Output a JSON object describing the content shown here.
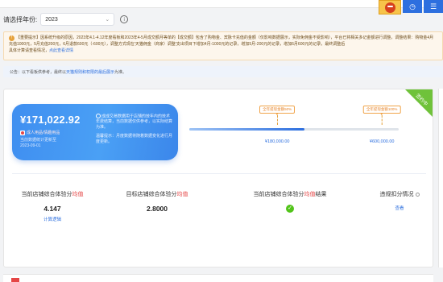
{
  "header": {
    "year_label": "请选择年份:",
    "year_value": "2023"
  },
  "notice": {
    "prefix": "【重要提示】",
    "text": "因系统升级的原因，2023年4.1-4.12年度看板和2023年4-5月成交额月等单的【成交额】包含了购物金、宾脉卡充值的金额（仅影响数据展示，实际免佣金不受影响），平台已将相关多记金额进行调整，调整结果：购物金4月充值1000元，5月充值200元，6月退款600元（-600元），调整方式现在'天猫佣金（商家）调整'支出项目下增加4月-1000元的记录，增加5月-200元的记录，增加6月600元的记录，最终调整后",
    "suffix": "具体计算请查看情况，",
    "link": "点此查看详情"
  },
  "reference": {
    "text": "公告：以下看板供参考，最终以",
    "link": "天猫规则和权限的最后展示",
    "suffix": "为准。"
  },
  "ribbon": "签约中",
  "card": {
    "amount": "¥171,022.92",
    "badge": "成人用品/情趣用品",
    "sub1": "当前数据统计更新至",
    "sub2": "2023-09-01",
    "desc": "成成交易数据用于店铺的技年内的技术年费结算，当前数据仅供参考，以实际结算为准。",
    "hint": "温馨提示：月度数据将随着数据变化进行月度更新。"
  },
  "progress": {
    "fraction": 0.55,
    "milestones": [
      {
        "tip": "全年提现金额50%",
        "value": "¥180,000.00",
        "at": 0.42
      },
      {
        "tip": "全年提现金额100%",
        "value": "¥600,000.00",
        "at": 0.92
      }
    ]
  },
  "metrics": {
    "m1": {
      "title_a": "当前店铺综合体验分",
      "title_hl": "均值",
      "value": "4.147",
      "link": "计算逻辑"
    },
    "m2": {
      "title_a": "目标店铺综合体验分",
      "title_hl": "均值",
      "value": "2.8000"
    },
    "m3": {
      "title_a": "当前店铺综合体验分",
      "title_hl": "均值",
      "title_b": "结果"
    },
    "m4": {
      "title": "违规扣分情况",
      "link": "查看"
    }
  }
}
